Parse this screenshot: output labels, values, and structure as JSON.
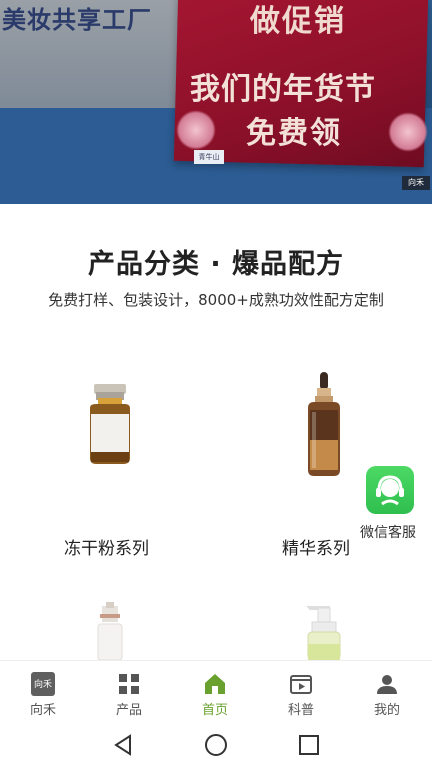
{
  "hero": {
    "wall_text": "美妆共享工厂",
    "banner_line1": "做促销",
    "banner_line2": "我们的年货节",
    "banner_line3": "免费领",
    "small_sign": "青牛山",
    "corner_logo": "向禾"
  },
  "section": {
    "title": "产品分类 · 爆品配方",
    "subtitle": "免费打样、包装设计，8000+成熟功效性配方定制"
  },
  "products": [
    {
      "label": "冻干粉系列",
      "icon": "vial-bottle-icon"
    },
    {
      "label": "精华系列",
      "icon": "dropper-bottle-icon"
    },
    {
      "label": "",
      "icon": "pump-bottle-icon"
    },
    {
      "label": "",
      "icon": "pump-gel-bottle-icon"
    }
  ],
  "floating": {
    "wechat_label": "微信客服",
    "color": "#2fbf4f"
  },
  "tabs": [
    {
      "label": "向禾",
      "icon": "brand-logo-icon"
    },
    {
      "label": "产品",
      "icon": "grid-icon"
    },
    {
      "label": "首页",
      "icon": "home-icon"
    },
    {
      "label": "科普",
      "icon": "video-icon"
    },
    {
      "label": "我的",
      "icon": "user-icon"
    }
  ],
  "theme": {
    "accent": "#6aa12e"
  }
}
